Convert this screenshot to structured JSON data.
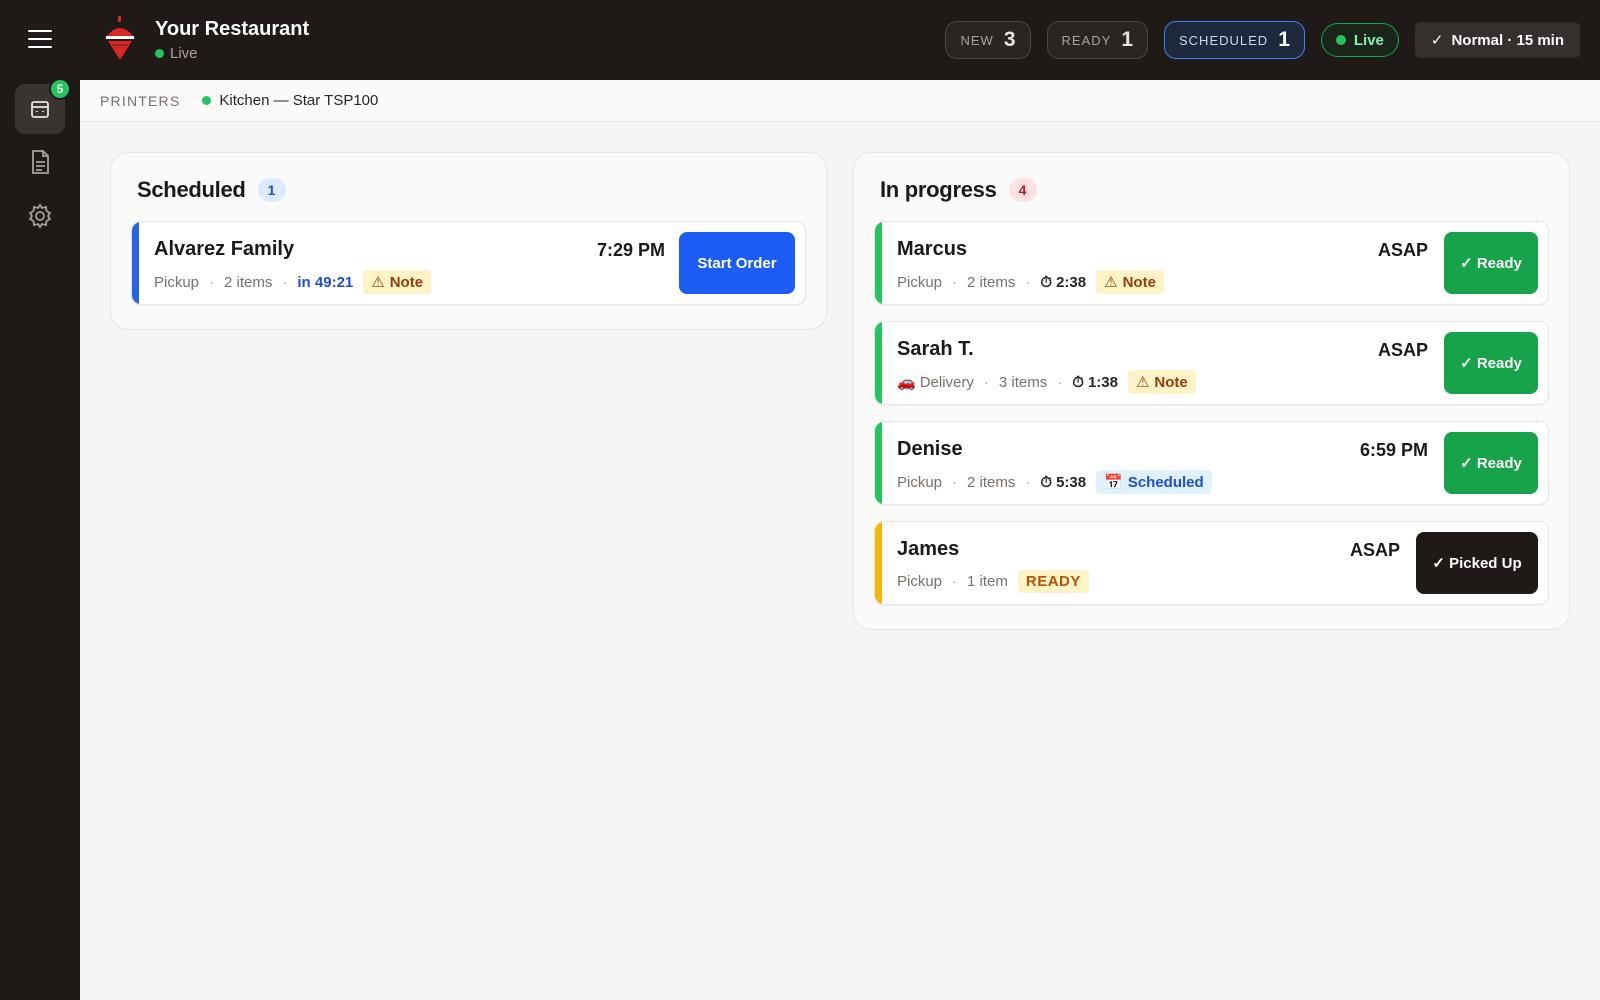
{
  "header": {
    "brand_name": "Your Restaurant",
    "brand_status": "Live",
    "pills": [
      {
        "label": "NEW",
        "count": "3"
      },
      {
        "label": "READY",
        "count": "1"
      },
      {
        "label": "SCHEDULED",
        "count": "1"
      }
    ],
    "live_label": "Live",
    "mode_label": "Normal · 15 min",
    "mode_check": "✓"
  },
  "rail": {
    "orders_badge": "5"
  },
  "printers": {
    "label": "PRINTERS",
    "items": [
      {
        "name": "Kitchen — Star TSP100"
      }
    ]
  },
  "scheduled": {
    "title": "Scheduled",
    "count": "1",
    "orders": [
      {
        "name": "Alvarez Family",
        "type": "Pickup",
        "items": "2 items",
        "eta": "in 49:21",
        "note": "Note",
        "time": "7:29 PM",
        "action": "Start Order"
      }
    ]
  },
  "in_progress": {
    "title": "In progress",
    "count": "4",
    "orders": [
      {
        "name": "Marcus",
        "type": "Pickup",
        "items": "2 items",
        "timer": "2:38",
        "tag": "Note",
        "time": "ASAP",
        "action": "✓ Ready"
      },
      {
        "name": "Sarah T.",
        "type": "Delivery",
        "items": "3 items",
        "timer": "1:38",
        "tag": "Note",
        "time": "ASAP",
        "action": "✓ Ready"
      },
      {
        "name": "Denise",
        "type": "Pickup",
        "items": "2 items",
        "timer": "5:38",
        "tag": "Scheduled",
        "time": "6:59 PM",
        "action": "✓ Ready"
      },
      {
        "name": "James",
        "type": "Pickup",
        "items": "1 item",
        "status": "READY",
        "time": "ASAP",
        "action": "✓ Picked Up"
      }
    ]
  },
  "colors": {
    "accent_blue": "#1d5cf5",
    "ready_green": "#16a34a",
    "stripe_blue": "#2563eb",
    "stripe_green": "#22c55e",
    "stripe_amber": "#f5b800",
    "dark": "#1f1a17"
  },
  "separator": "·"
}
